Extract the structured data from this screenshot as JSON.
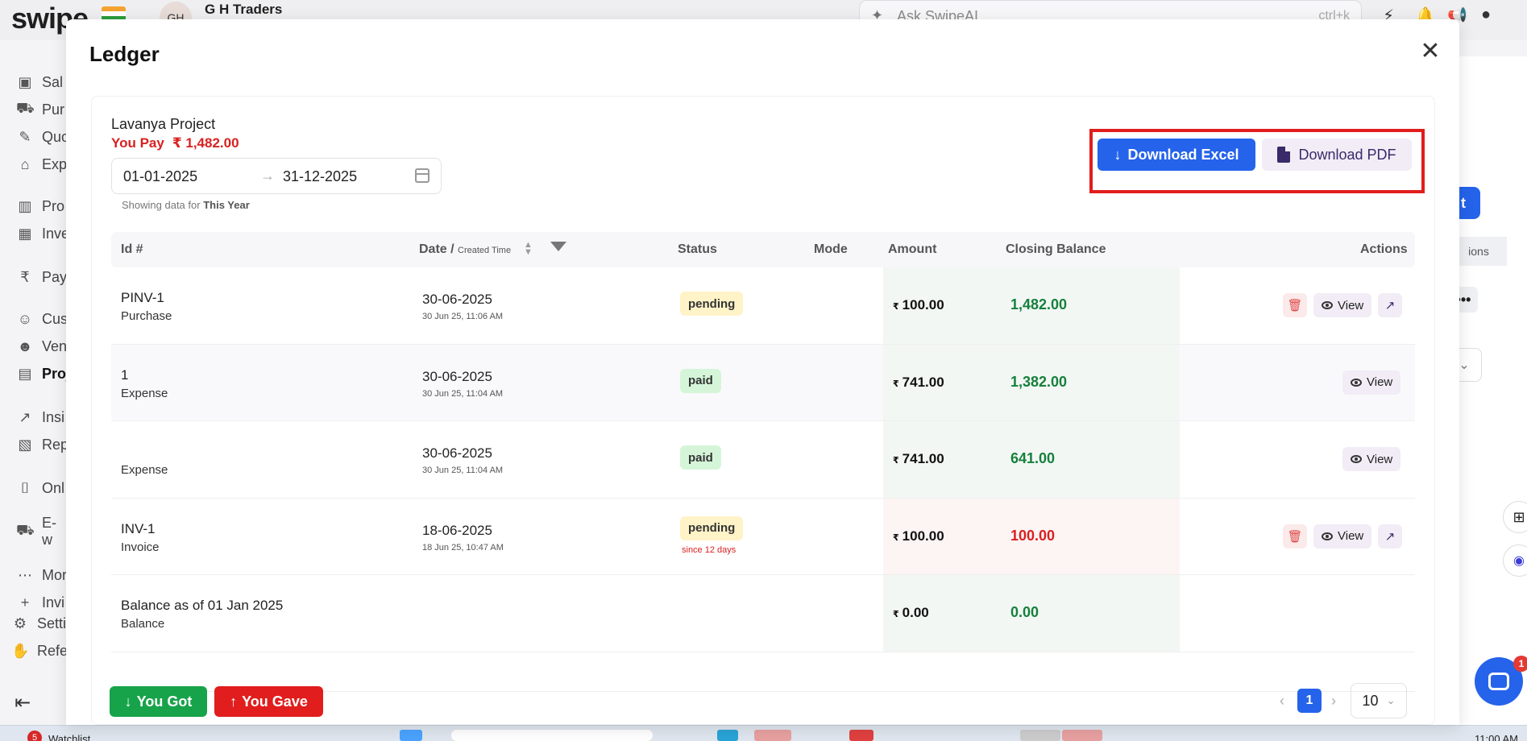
{
  "app": {
    "logo": "swipe",
    "org_initials": "GH",
    "org_name": "G H Traders",
    "ask_placeholder": "Ask SwipeAI",
    "ask_shortcut": "ctrl+k",
    "sidebar": [
      {
        "label": "Sal",
        "icon": "sales-icon"
      },
      {
        "label": "Pur",
        "icon": "purchase-icon"
      },
      {
        "label": "Quo",
        "icon": "quotation-icon"
      },
      {
        "label": "Exp",
        "icon": "expense-icon"
      },
      {
        "label": "Pro",
        "icon": "products-icon"
      },
      {
        "label": "Inve",
        "icon": "inventory-icon"
      },
      {
        "label": "Pay",
        "icon": "payments-icon"
      },
      {
        "label": "Cus",
        "icon": "customers-icon"
      },
      {
        "label": "Ven",
        "icon": "vendors-icon"
      },
      {
        "label": "Proj",
        "icon": "projects-icon"
      },
      {
        "label": "Insi",
        "icon": "insights-icon"
      },
      {
        "label": "Rep",
        "icon": "reports-icon"
      },
      {
        "label": "Onl",
        "icon": "online-store-icon"
      },
      {
        "label": "E-w",
        "icon": "eway-icon"
      },
      {
        "label": "Mor",
        "icon": "more-icon"
      },
      {
        "label": "Invi",
        "icon": "invite-icon"
      },
      {
        "label": "Setti",
        "icon": "settings-icon"
      },
      {
        "label": "Refe",
        "icon": "refer-icon"
      }
    ],
    "right_chip": "ions",
    "right_btn": "t",
    "chat_badge": "1"
  },
  "taskbar": {
    "badge": "5",
    "label": "Watchlist",
    "clock": "11:00 AM"
  },
  "modal": {
    "title": "Ledger",
    "party_name": "Lavanya Project",
    "you_pay_label": "You Pay",
    "you_pay_amount": "₹ 1,482.00",
    "date_from": "01-01-2025",
    "date_to": "31-12-2025",
    "showing_prefix": "Showing data for",
    "showing_period": "This Year",
    "download_excel": "Download Excel",
    "download_pdf": "Download PDF",
    "columns": {
      "id": "Id #",
      "date": "Date /",
      "created": "Created Time",
      "status": "Status",
      "mode": "Mode",
      "amount": "Amount",
      "closing": "Closing Balance",
      "actions": "Actions"
    },
    "rows": [
      {
        "id": "PINV-1",
        "type": "Purchase",
        "date": "30-06-2025",
        "created": "30 Jun 25, 11:06 AM",
        "status": "pending",
        "status_sub": "",
        "amount": "100.00",
        "closing": "1,482.00",
        "view": "View"
      },
      {
        "id": "1",
        "type": "Expense",
        "date": "30-06-2025",
        "created": "30 Jun 25, 11:04 AM",
        "status": "paid",
        "status_sub": "",
        "amount": "741.00",
        "closing": "1,382.00",
        "view": "View"
      },
      {
        "id": "",
        "type": "Expense",
        "date": "30-06-2025",
        "created": "30 Jun 25, 11:04 AM",
        "status": "paid",
        "status_sub": "",
        "amount": "741.00",
        "closing": "641.00",
        "view": "View"
      },
      {
        "id": "INV-1",
        "type": "Invoice",
        "date": "18-06-2025",
        "created": "18 Jun 25, 10:47 AM",
        "status": "pending",
        "status_sub": "since 12 days",
        "amount": "100.00",
        "closing": "100.00",
        "view": "View"
      },
      {
        "id": "Balance as of 01 Jan 2025",
        "type": "Balance",
        "date": "",
        "created": "",
        "status": "",
        "status_sub": "",
        "amount": "0.00",
        "closing": "0.00",
        "view": ""
      }
    ],
    "currency_symbol": "₹",
    "you_got": "You Got",
    "you_gave": "You Gave",
    "page_current": "1",
    "page_size": "10"
  }
}
